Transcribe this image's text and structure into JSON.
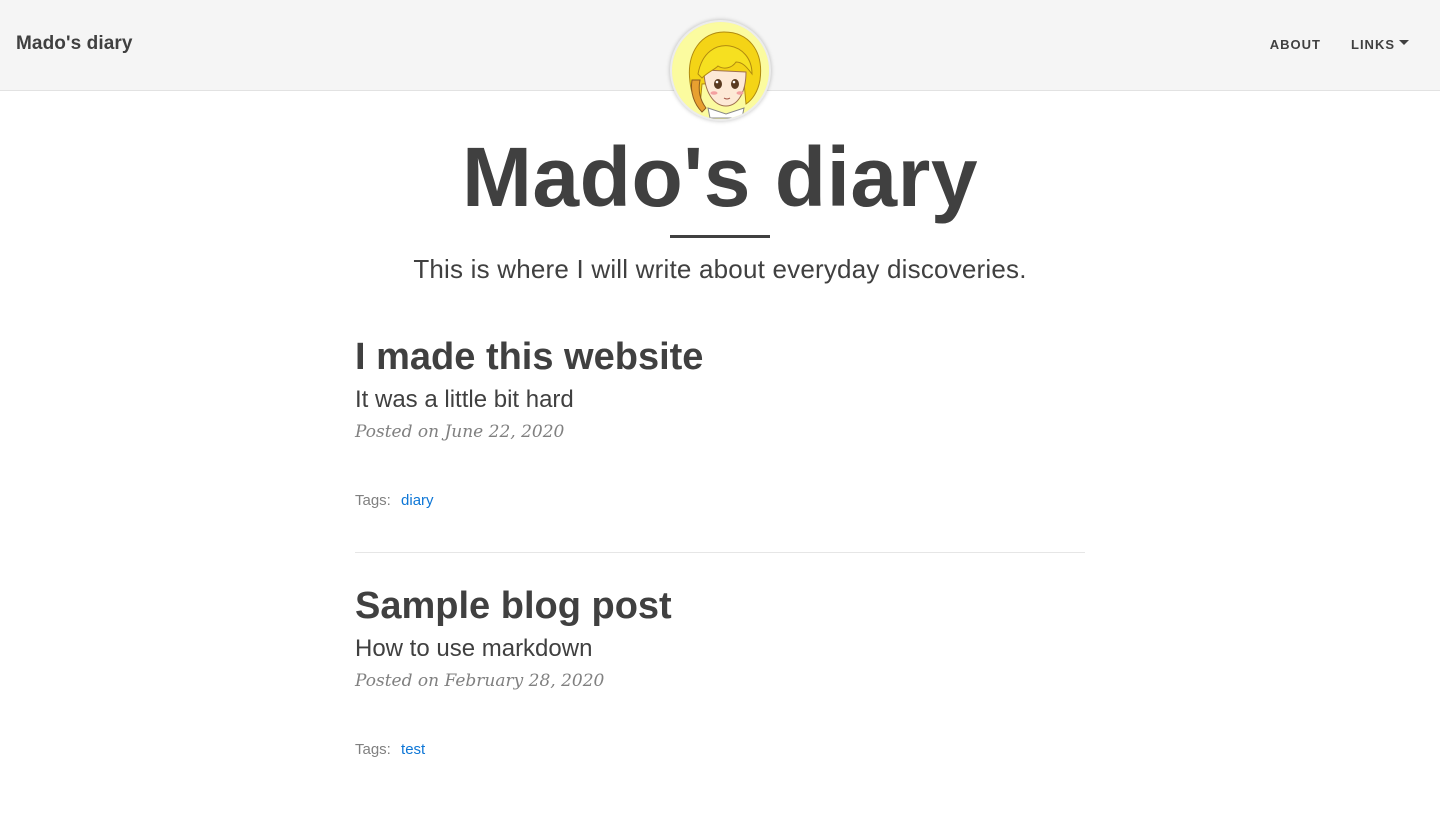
{
  "navbar": {
    "brand": "Mado's diary",
    "links": [
      {
        "label": "ABOUT"
      },
      {
        "label": "LINKS",
        "has_dropdown": true
      }
    ]
  },
  "avatar": {
    "icon": "avatar-anime-girl-icon"
  },
  "header": {
    "title": "Mado's diary",
    "subtitle": "This is where I will write about everyday discoveries."
  },
  "posts": [
    {
      "title": "I made this website",
      "subtitle": "It was a little bit hard",
      "meta": "Posted on June 22, 2020",
      "tags_label": "Tags:",
      "tags": [
        "diary"
      ]
    },
    {
      "title": "Sample blog post",
      "subtitle": "How to use markdown",
      "meta": "Posted on February 28, 2020",
      "tags_label": "Tags:",
      "tags": [
        "test"
      ]
    }
  ],
  "colors": {
    "text": "#404040",
    "muted": "#808080",
    "link": "#0d76d6",
    "navbar_bg": "#f5f5f5"
  }
}
